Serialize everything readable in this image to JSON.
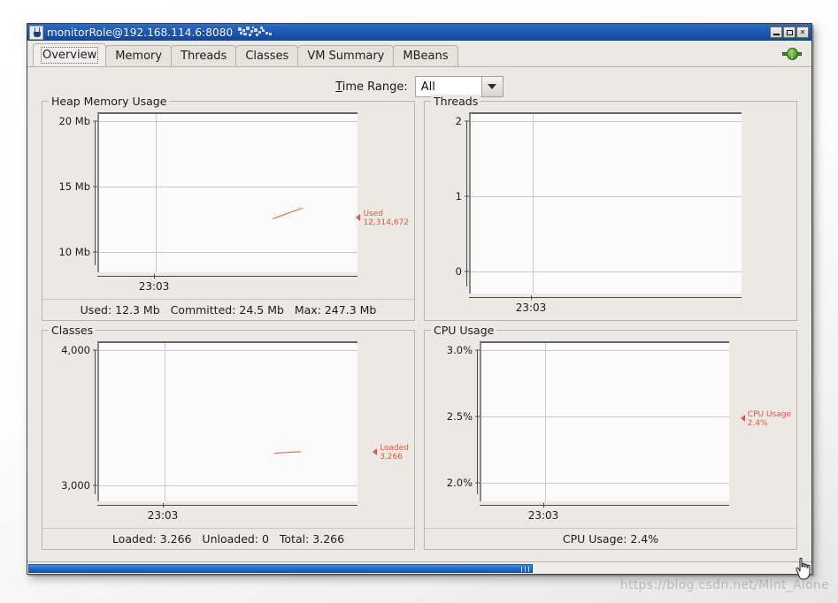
{
  "window": {
    "title": "monitorRole@192.168.114.6:8080",
    "icon": "java-cup-icon",
    "buttons": [
      {
        "name": "minimize",
        "glyph": "minimize-icon"
      },
      {
        "name": "restore",
        "glyph": "restore-icon"
      },
      {
        "name": "close",
        "glyph": "close-icon"
      }
    ]
  },
  "tabs": [
    {
      "label": "Overview",
      "selected": true
    },
    {
      "label": "Memory",
      "selected": false
    },
    {
      "label": "Threads",
      "selected": false
    },
    {
      "label": "Classes",
      "selected": false
    },
    {
      "label": "VM Summary",
      "selected": false
    },
    {
      "label": "MBeans",
      "selected": false
    }
  ],
  "connection_indicator": {
    "icon": "connected-plug-icon",
    "color": "#4f9b31"
  },
  "toolbar": {
    "time_range_label_prefix": "T",
    "time_range_label_rest": "ime Range:",
    "time_range_value": "All",
    "time_range_options": [
      "All"
    ]
  },
  "accent_color": "#e8573c",
  "chart_data": [
    {
      "type": "line",
      "title": "Heap Memory Usage",
      "panel_id": "heap-memory-usage",
      "xlabel": "",
      "ylabel": "",
      "x_ticks": [
        "23:03"
      ],
      "y_ticks": [
        "20 Mb",
        "15 Mb",
        "10 Mb"
      ],
      "ylim": [
        10,
        20
      ],
      "y_values_numeric": [
        20,
        15,
        10
      ],
      "grid": true,
      "series": [
        {
          "name": "Used",
          "value_label": "12,314,672",
          "value": 12314672,
          "color": "#e8573c"
        }
      ],
      "legend_position": "right",
      "footer": "Used: 12.3 Mb   Committed: 24.5 Mb   Max: 247.3 Mb",
      "footer_items": [
        {
          "label": "Used:",
          "value": "12.3 Mb"
        },
        {
          "label": "Committed:",
          "value": "24.5 Mb"
        },
        {
          "label": "Max:",
          "value": "247.3 Mb"
        }
      ]
    },
    {
      "type": "line",
      "title": "Threads",
      "panel_id": "threads",
      "xlabel": "",
      "ylabel": "",
      "x_ticks": [
        "23:03"
      ],
      "y_ticks": [
        "2",
        "1",
        "0"
      ],
      "ylim": [
        0,
        2
      ],
      "y_values_numeric": [
        2,
        1,
        0
      ],
      "grid": true,
      "series": [],
      "legend_position": "right",
      "footer": ""
    },
    {
      "type": "line",
      "title": "Classes",
      "panel_id": "classes",
      "xlabel": "",
      "ylabel": "",
      "x_ticks": [
        "23:03"
      ],
      "y_ticks": [
        "4,000",
        "3,000"
      ],
      "ylim": [
        3000,
        4000
      ],
      "y_values_numeric": [
        4000,
        3000
      ],
      "grid": true,
      "series": [
        {
          "name": "Loaded",
          "value_label": "3,266",
          "value": 3266,
          "color": "#e8573c"
        }
      ],
      "legend_position": "right",
      "footer": "Loaded: 3.266   Unloaded: 0   Total: 3.266",
      "footer_items": [
        {
          "label": "Loaded:",
          "value": "3.266"
        },
        {
          "label": "Unloaded:",
          "value": "0"
        },
        {
          "label": "Total:",
          "value": "3.266"
        }
      ]
    },
    {
      "type": "line",
      "title": "CPU Usage",
      "panel_id": "cpu-usage",
      "xlabel": "",
      "ylabel": "",
      "x_ticks": [
        "23:03"
      ],
      "y_ticks": [
        "3.0%",
        "2.5%",
        "2.0%"
      ],
      "ylim": [
        2.0,
        3.0
      ],
      "y_values_numeric": [
        3.0,
        2.5,
        2.0
      ],
      "grid": true,
      "series": [
        {
          "name": "CPU Usage",
          "value_label": "2.4%",
          "value": 2.4,
          "color": "#e8573c"
        }
      ],
      "legend_position": "right",
      "footer": "CPU Usage: 2.4%",
      "footer_items": [
        {
          "label": "CPU Usage:",
          "value": "2.4%"
        }
      ]
    }
  ],
  "scrollbar": {
    "orientation": "horizontal",
    "thumb_color": "#1f6fd0"
  },
  "watermark": "https://blog.csdn.net/Mint_Alone"
}
